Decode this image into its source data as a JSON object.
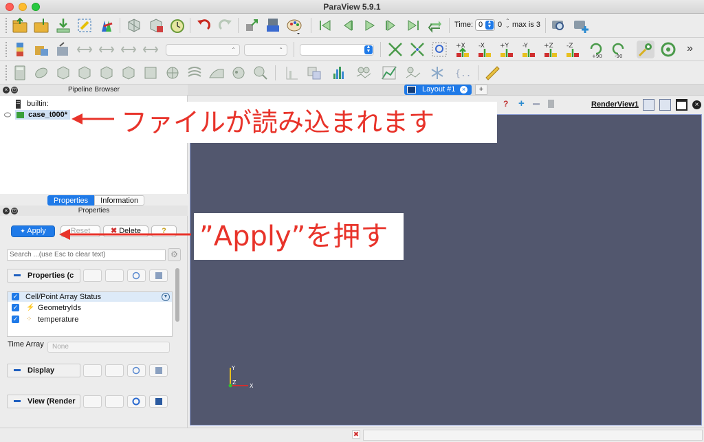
{
  "window": {
    "title": "ParaView 5.9.1"
  },
  "toolbar": {
    "time_label": "Time:",
    "time_value": "0",
    "timestep_value": "0",
    "max_label": "max is 3"
  },
  "pipeline_browser": {
    "title": "Pipeline Browser",
    "items": [
      {
        "label": "builtin:"
      },
      {
        "label": "case_t000*"
      }
    ]
  },
  "panel_tabs": {
    "properties": "Properties",
    "information": "Information"
  },
  "properties_panel": {
    "title": "Properties",
    "apply": "Apply",
    "reset": "Reset",
    "delete": "Delete",
    "help": "?",
    "search_placeholder": "Search ...(use Esc to clear text)",
    "section_properties": "Properties (c",
    "array_header": "Cell/Point Array Status",
    "arrays": [
      {
        "label": "GeometryIds",
        "checked": true
      },
      {
        "label": "temperature",
        "checked": true
      }
    ],
    "time_array_label": "Time Array",
    "time_array_value": "None",
    "section_display": "Display",
    "section_view": "View (Render"
  },
  "layout": {
    "tab_label": "Layout #1",
    "add": "+",
    "view_name": "RenderView1"
  },
  "axes": {
    "x": "X",
    "y": "Y",
    "z": "Z"
  },
  "annotations": {
    "file_loaded": "ファイルが読み込まれます",
    "press_apply": "”Apply”を押す"
  },
  "colors": {
    "accent": "#1f7ae8",
    "render_background": "#52576e",
    "annotation_red": "#e8332a"
  }
}
